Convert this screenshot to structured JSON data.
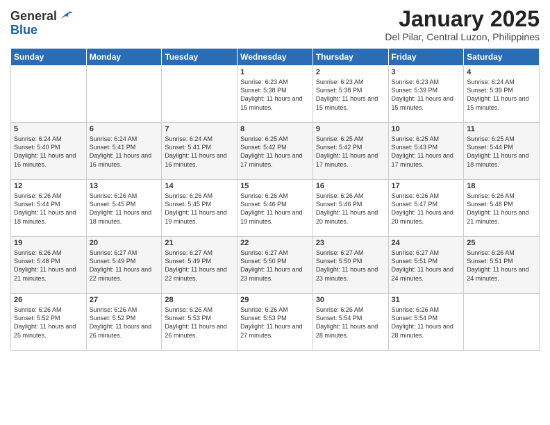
{
  "logo": {
    "general": "General",
    "blue": "Blue"
  },
  "header": {
    "month": "January 2025",
    "location": "Del Pilar, Central Luzon, Philippines"
  },
  "weekdays": [
    "Sunday",
    "Monday",
    "Tuesday",
    "Wednesday",
    "Thursday",
    "Friday",
    "Saturday"
  ],
  "weeks": [
    [
      {
        "day": null,
        "sunrise": null,
        "sunset": null,
        "daylight": null
      },
      {
        "day": null,
        "sunrise": null,
        "sunset": null,
        "daylight": null
      },
      {
        "day": null,
        "sunrise": null,
        "sunset": null,
        "daylight": null
      },
      {
        "day": "1",
        "sunrise": "Sunrise: 6:23 AM",
        "sunset": "Sunset: 5:38 PM",
        "daylight": "Daylight: 11 hours and 15 minutes."
      },
      {
        "day": "2",
        "sunrise": "Sunrise: 6:23 AM",
        "sunset": "Sunset: 5:38 PM",
        "daylight": "Daylight: 11 hours and 15 minutes."
      },
      {
        "day": "3",
        "sunrise": "Sunrise: 6:23 AM",
        "sunset": "Sunset: 5:39 PM",
        "daylight": "Daylight: 11 hours and 15 minutes."
      },
      {
        "day": "4",
        "sunrise": "Sunrise: 6:24 AM",
        "sunset": "Sunset: 5:39 PM",
        "daylight": "Daylight: 11 hours and 15 minutes."
      }
    ],
    [
      {
        "day": "5",
        "sunrise": "Sunrise: 6:24 AM",
        "sunset": "Sunset: 5:40 PM",
        "daylight": "Daylight: 11 hours and 16 minutes."
      },
      {
        "day": "6",
        "sunrise": "Sunrise: 6:24 AM",
        "sunset": "Sunset: 5:41 PM",
        "daylight": "Daylight: 11 hours and 16 minutes."
      },
      {
        "day": "7",
        "sunrise": "Sunrise: 6:24 AM",
        "sunset": "Sunset: 5:41 PM",
        "daylight": "Daylight: 11 hours and 16 minutes."
      },
      {
        "day": "8",
        "sunrise": "Sunrise: 6:25 AM",
        "sunset": "Sunset: 5:42 PM",
        "daylight": "Daylight: 11 hours and 17 minutes."
      },
      {
        "day": "9",
        "sunrise": "Sunrise: 6:25 AM",
        "sunset": "Sunset: 5:42 PM",
        "daylight": "Daylight: 11 hours and 17 minutes."
      },
      {
        "day": "10",
        "sunrise": "Sunrise: 6:25 AM",
        "sunset": "Sunset: 5:43 PM",
        "daylight": "Daylight: 11 hours and 17 minutes."
      },
      {
        "day": "11",
        "sunrise": "Sunrise: 6:25 AM",
        "sunset": "Sunset: 5:44 PM",
        "daylight": "Daylight: 11 hours and 18 minutes."
      }
    ],
    [
      {
        "day": "12",
        "sunrise": "Sunrise: 6:26 AM",
        "sunset": "Sunset: 5:44 PM",
        "daylight": "Daylight: 11 hours and 18 minutes."
      },
      {
        "day": "13",
        "sunrise": "Sunrise: 6:26 AM",
        "sunset": "Sunset: 5:45 PM",
        "daylight": "Daylight: 11 hours and 18 minutes."
      },
      {
        "day": "14",
        "sunrise": "Sunrise: 6:26 AM",
        "sunset": "Sunset: 5:45 PM",
        "daylight": "Daylight: 11 hours and 19 minutes."
      },
      {
        "day": "15",
        "sunrise": "Sunrise: 6:26 AM",
        "sunset": "Sunset: 5:46 PM",
        "daylight": "Daylight: 11 hours and 19 minutes."
      },
      {
        "day": "16",
        "sunrise": "Sunrise: 6:26 AM",
        "sunset": "Sunset: 5:46 PM",
        "daylight": "Daylight: 11 hours and 20 minutes."
      },
      {
        "day": "17",
        "sunrise": "Sunrise: 6:26 AM",
        "sunset": "Sunset: 5:47 PM",
        "daylight": "Daylight: 11 hours and 20 minutes."
      },
      {
        "day": "18",
        "sunrise": "Sunrise: 6:26 AM",
        "sunset": "Sunset: 5:48 PM",
        "daylight": "Daylight: 11 hours and 21 minutes."
      }
    ],
    [
      {
        "day": "19",
        "sunrise": "Sunrise: 6:26 AM",
        "sunset": "Sunset: 5:48 PM",
        "daylight": "Daylight: 11 hours and 21 minutes."
      },
      {
        "day": "20",
        "sunrise": "Sunrise: 6:27 AM",
        "sunset": "Sunset: 5:49 PM",
        "daylight": "Daylight: 11 hours and 22 minutes."
      },
      {
        "day": "21",
        "sunrise": "Sunrise: 6:27 AM",
        "sunset": "Sunset: 5:49 PM",
        "daylight": "Daylight: 11 hours and 22 minutes."
      },
      {
        "day": "22",
        "sunrise": "Sunrise: 6:27 AM",
        "sunset": "Sunset: 5:50 PM",
        "daylight": "Daylight: 11 hours and 23 minutes."
      },
      {
        "day": "23",
        "sunrise": "Sunrise: 6:27 AM",
        "sunset": "Sunset: 5:50 PM",
        "daylight": "Daylight: 11 hours and 23 minutes."
      },
      {
        "day": "24",
        "sunrise": "Sunrise: 6:27 AM",
        "sunset": "Sunset: 5:51 PM",
        "daylight": "Daylight: 11 hours and 24 minutes."
      },
      {
        "day": "25",
        "sunrise": "Sunrise: 6:26 AM",
        "sunset": "Sunset: 5:51 PM",
        "daylight": "Daylight: 11 hours and 24 minutes."
      }
    ],
    [
      {
        "day": "26",
        "sunrise": "Sunrise: 6:26 AM",
        "sunset": "Sunset: 5:52 PM",
        "daylight": "Daylight: 11 hours and 25 minutes."
      },
      {
        "day": "27",
        "sunrise": "Sunrise: 6:26 AM",
        "sunset": "Sunset: 5:52 PM",
        "daylight": "Daylight: 11 hours and 26 minutes."
      },
      {
        "day": "28",
        "sunrise": "Sunrise: 6:26 AM",
        "sunset": "Sunset: 5:53 PM",
        "daylight": "Daylight: 11 hours and 26 minutes."
      },
      {
        "day": "29",
        "sunrise": "Sunrise: 6:26 AM",
        "sunset": "Sunset: 5:53 PM",
        "daylight": "Daylight: 11 hours and 27 minutes."
      },
      {
        "day": "30",
        "sunrise": "Sunrise: 6:26 AM",
        "sunset": "Sunset: 5:54 PM",
        "daylight": "Daylight: 11 hours and 28 minutes."
      },
      {
        "day": "31",
        "sunrise": "Sunrise: 6:26 AM",
        "sunset": "Sunset: 5:54 PM",
        "daylight": "Daylight: 11 hours and 28 minutes."
      },
      {
        "day": null,
        "sunrise": null,
        "sunset": null,
        "daylight": null
      }
    ]
  ]
}
